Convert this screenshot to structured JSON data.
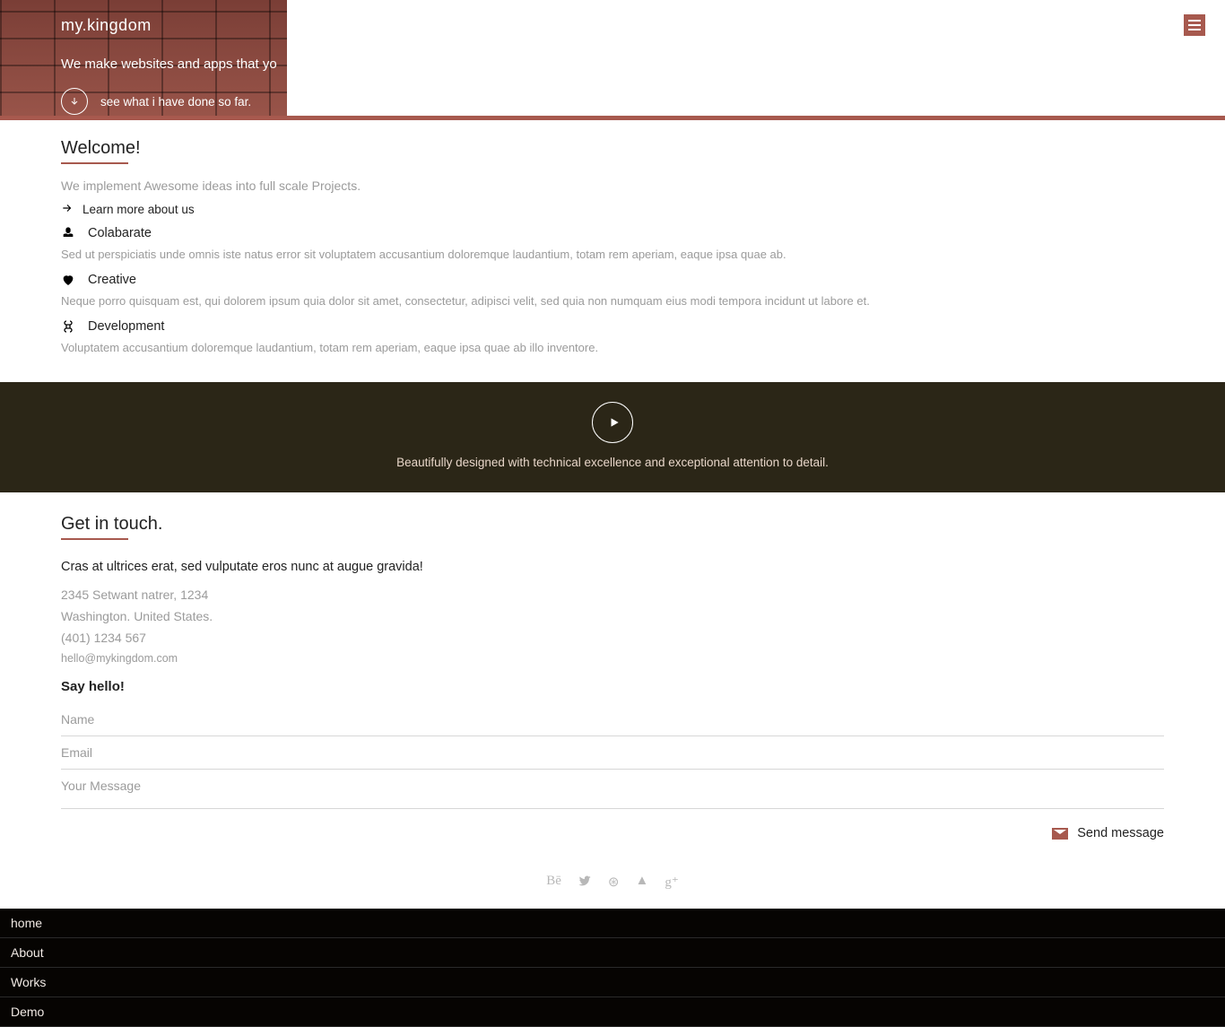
{
  "hero": {
    "logo": "my.kingdom",
    "tagline": "We make websites and apps that yo",
    "see_link": "see what i have done so far."
  },
  "welcome": {
    "title": "Welcome!",
    "subtitle": "We implement Awesome ideas into full scale Projects.",
    "learn_more": "Learn more about us",
    "features": [
      {
        "label": "Colabarate",
        "desc": "Sed ut perspiciatis unde omnis iste natus error sit voluptatem accusantium doloremque laudantium, totam rem aperiam, eaque ipsa quae ab."
      },
      {
        "label": "Creative",
        "desc": "Neque porro quisquam est, qui dolorem ipsum quia dolor sit amet, consectetur, adipisci velit, sed quia non numquam eius modi tempora incidunt ut labore et."
      },
      {
        "label": "Development",
        "desc": "Voluptatem accusantium doloremque laudantium, totam rem aperiam, eaque ipsa quae ab illo inventore."
      }
    ]
  },
  "band": {
    "caption": "Beautifully designed with technical excellence and exceptional attention to detail."
  },
  "contact": {
    "title": "Get in touch.",
    "lead": "Cras at ultrices erat, sed vulputate eros nunc at augue gravida!",
    "addr_line1": "2345 Setwant natrer, 1234",
    "addr_line2": "Washington. United States.",
    "phone": "(401) 1234 567",
    "email": "hello@mykingdom.com",
    "form_title": "Say hello!",
    "ph_name": "Name",
    "ph_email": "Email",
    "ph_msg": "Your Message",
    "send_label": "Send message"
  },
  "social": {
    "behance": "Bē",
    "twitter": "t",
    "dribbble": "⊛",
    "forrst": "▲",
    "gplus": "g⁺"
  },
  "footernav": {
    "items": [
      "home",
      "About",
      "Works",
      "Demo"
    ]
  }
}
